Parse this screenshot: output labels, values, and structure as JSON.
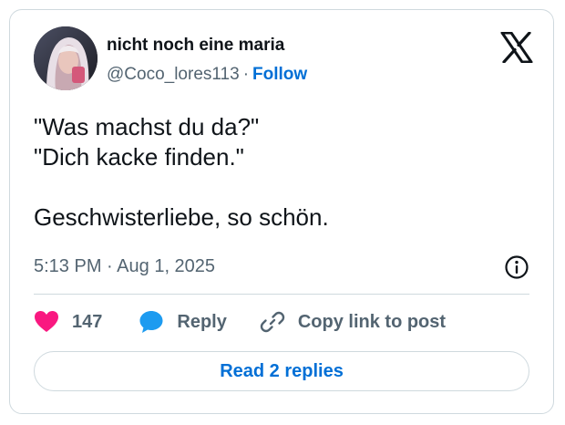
{
  "author": {
    "display_name": "nicht noch eine maria",
    "handle": "@Coco_lores113",
    "separator": "·",
    "follow_label": "Follow"
  },
  "tweet": {
    "lines": [
      "\"Was machst du da?\"",
      "\"Dich kacke finden.\"",
      "Geschwisterliebe, so schön."
    ],
    "time": "5:13 PM",
    "time_separator": "·",
    "date": "Aug 1, 2025"
  },
  "actions": {
    "like_count": "147",
    "reply_label": "Reply",
    "copy_link_label": "Copy link to post"
  },
  "read_replies_label": "Read 2 replies",
  "icons": {
    "brand": "x-logo-icon",
    "info": "info-icon",
    "like": "heart-icon",
    "reply": "speech-bubble-icon",
    "copy": "link-icon"
  },
  "colors": {
    "heart": "#f91880",
    "reply_bubble": "#1d9bf0",
    "link_blue": "#006fd6",
    "secondary_text": "#536471",
    "border": "#cfd9de"
  }
}
